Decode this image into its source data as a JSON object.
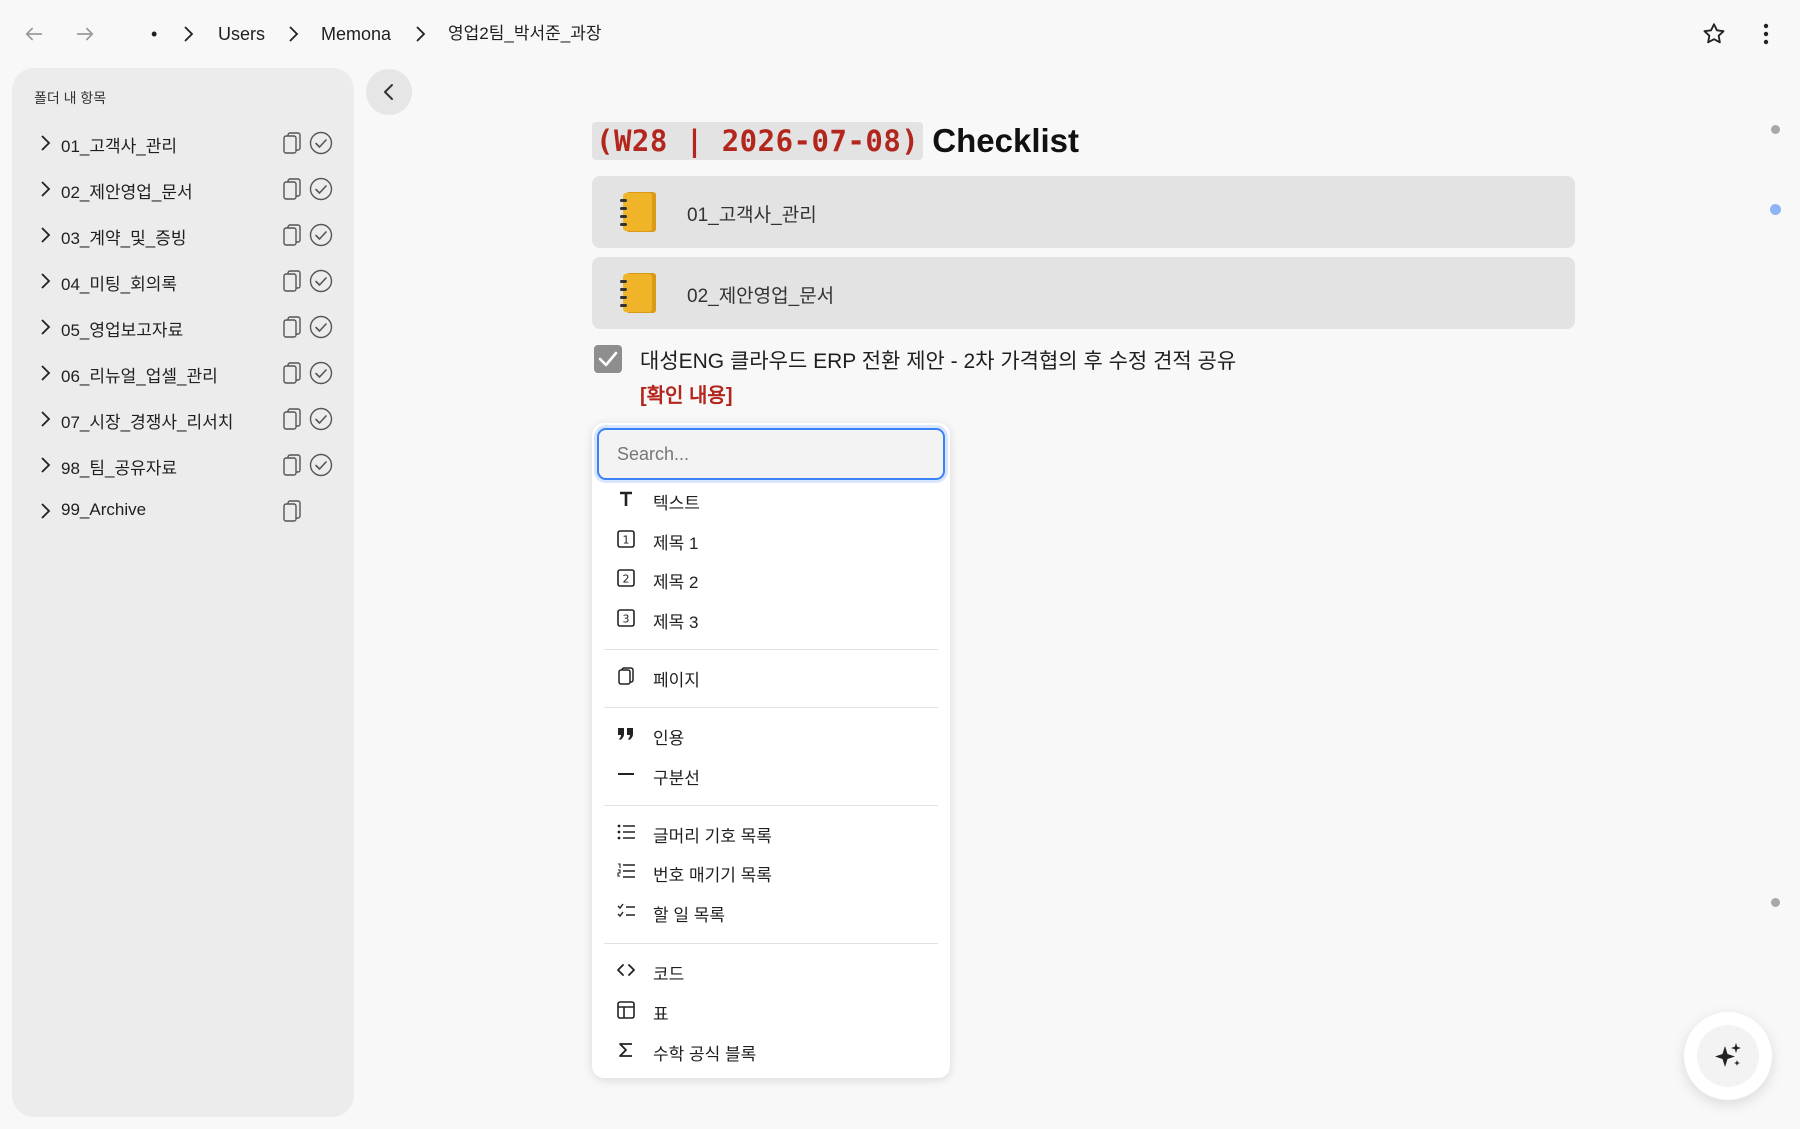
{
  "breadcrumb": {
    "root": "•",
    "items": [
      "Users",
      "Memona",
      "영업2팀_박서준_과장"
    ]
  },
  "sidebar": {
    "title": "폴더 내 항목",
    "items": [
      {
        "label": "01_고객사_관리",
        "has_check": true
      },
      {
        "label": "02_제안영업_문서",
        "has_check": true
      },
      {
        "label": "03_계약_및_증빙",
        "has_check": true
      },
      {
        "label": "04_미팅_회의록",
        "has_check": true
      },
      {
        "label": "05_영업보고자료",
        "has_check": true
      },
      {
        "label": "06_리뉴얼_업셀_관리",
        "has_check": true
      },
      {
        "label": "07_시장_경쟁사_리서치",
        "has_check": true
      },
      {
        "label": "98_팀_공유자료",
        "has_check": true
      },
      {
        "label": "99_Archive",
        "has_check": false
      }
    ]
  },
  "document": {
    "title_code": "(W28 | 2026-07-08)",
    "title_text": "Checklist",
    "links": [
      {
        "label": "01_고객사_관리",
        "icon": "notebook-icon"
      },
      {
        "label": "02_제안영업_문서",
        "icon": "notebook-icon"
      }
    ],
    "todo": {
      "checked": true,
      "text": "대성ENG 클라우드 ERP 전환 제안 - 2차 가격협의 후 수정 견적 공유",
      "note": "[확인 내용]"
    }
  },
  "block_menu": {
    "search_placeholder": "Search...",
    "items": [
      {
        "label": "텍스트",
        "icon": "text-icon"
      },
      {
        "label": "제목 1",
        "icon": "heading-1-icon"
      },
      {
        "label": "제목 2",
        "icon": "heading-2-icon"
      },
      {
        "label": "제목 3",
        "icon": "heading-3-icon"
      },
      {
        "label": "페이지",
        "icon": "page-icon"
      },
      {
        "label": "인용",
        "icon": "quote-icon"
      },
      {
        "label": "구분선",
        "icon": "divider-icon"
      },
      {
        "label": "글머리 기호 목록",
        "icon": "bullet-list-icon"
      },
      {
        "label": "번호 매기기 목록",
        "icon": "numbered-list-icon"
      },
      {
        "label": "할 일 목록",
        "icon": "todo-list-icon"
      },
      {
        "label": "코드",
        "icon": "code-icon"
      },
      {
        "label": "표",
        "icon": "table-icon"
      },
      {
        "label": "수학 공식 블록",
        "icon": "math-icon"
      }
    ]
  },
  "colors": {
    "accent": "#3b82f6",
    "code_red": "#b3261e",
    "notebook": "#f0b429"
  }
}
